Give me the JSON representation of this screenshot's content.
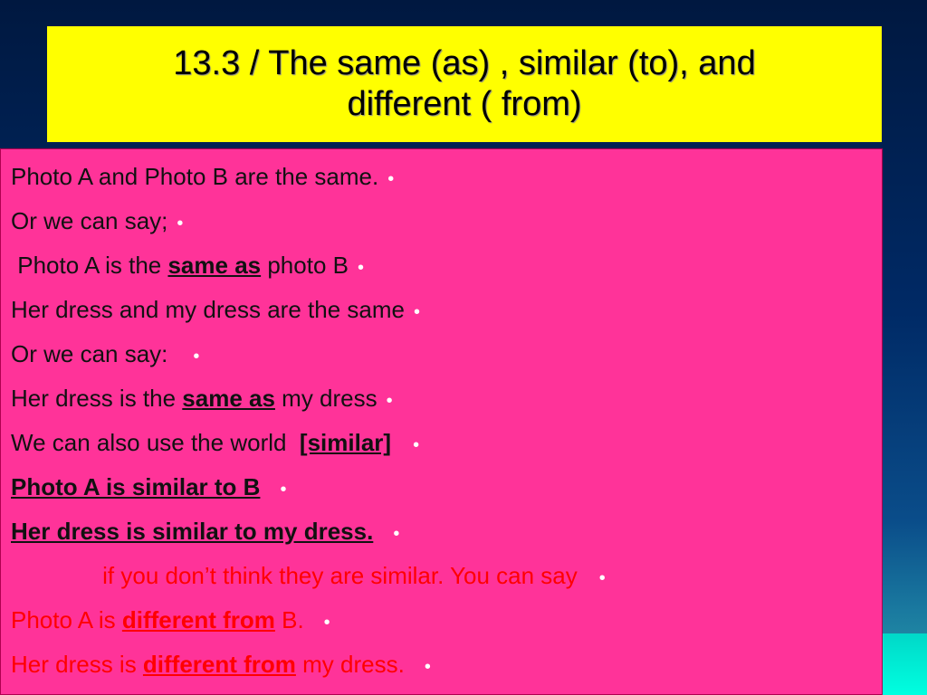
{
  "title": {
    "line1": "13.3 / The same (as) , similar (to), and",
    "line2": "different ( from)"
  },
  "bullet_glyph": "•",
  "colors": {
    "title_bg": "#ffff00",
    "content_bg": "#ff3399",
    "red_text": "#ff0000"
  },
  "lines": [
    {
      "pre": "Photo A and Photo B are the same.",
      "emph": "",
      "post": ""
    },
    {
      "pre": "Or we can say;",
      "emph": "",
      "post": ""
    },
    {
      "pre": " Photo A is the ",
      "emph": "same as",
      "post": " photo B"
    },
    {
      "pre": "Her dress and my dress are the same",
      "emph": "",
      "post": ""
    },
    {
      "pre": "Or we can say:",
      "emph": "",
      "post": ""
    },
    {
      "pre": "Her dress is the ",
      "emph": "same as",
      "post": " my dress"
    },
    {
      "pre": "We can also use the world  ",
      "emph": "[similar]",
      "post": ""
    },
    {
      "pre": "",
      "emph": "Photo A is similar to B",
      "post": ""
    },
    {
      "pre": "",
      "emph": "Her dress is similar to my dress.",
      "post": ""
    },
    {
      "pre": "              if you don’t think they are similar. You can say",
      "emph": "",
      "post": ""
    },
    {
      "pre": "Photo A is ",
      "emph": "different from",
      "post": " B."
    },
    {
      "pre": "Her dress is ",
      "emph": "different from",
      "post": " my dress."
    }
  ]
}
